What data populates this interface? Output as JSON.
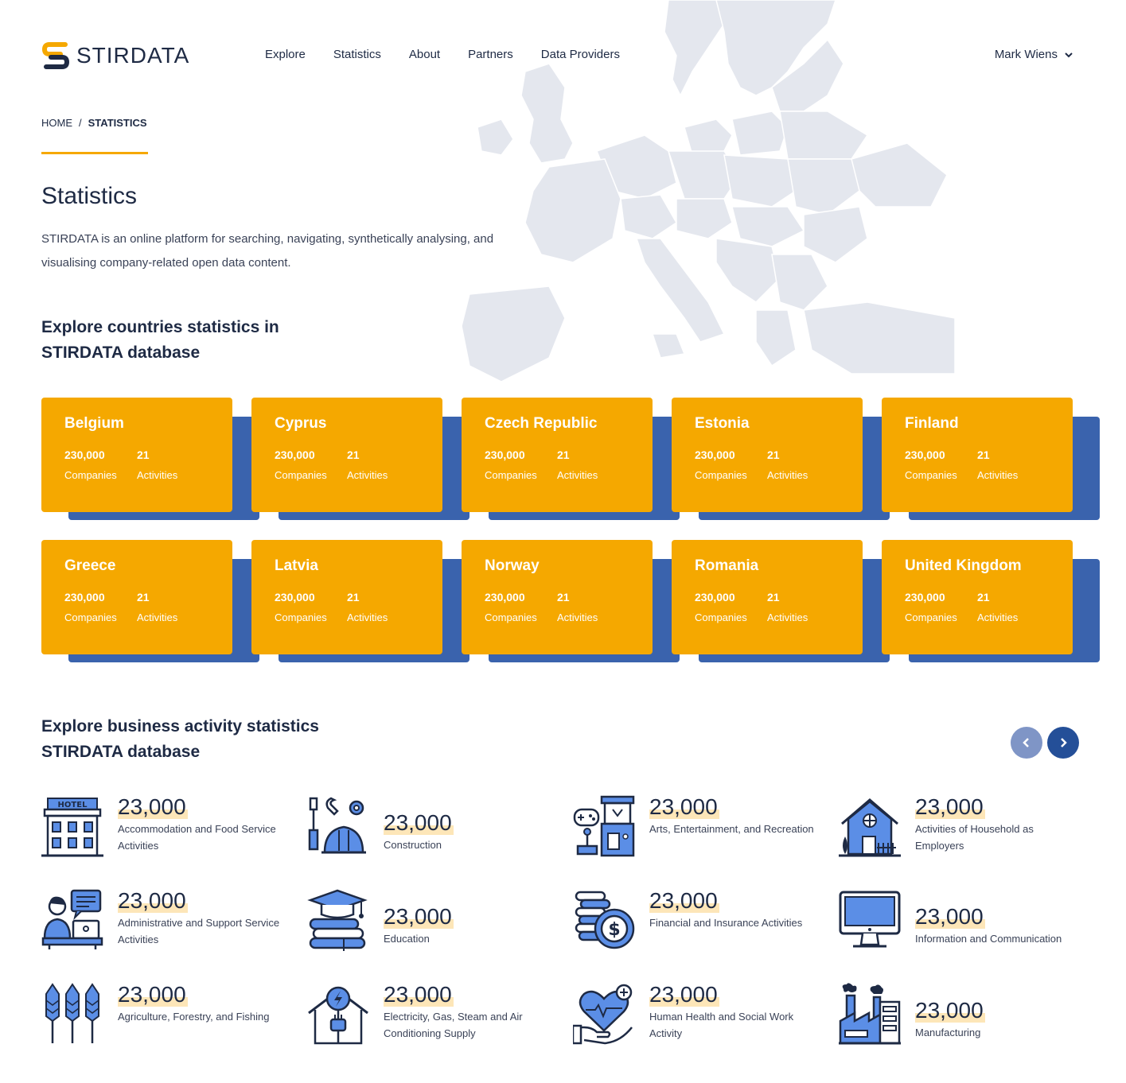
{
  "brand": {
    "name": "STIRDATA"
  },
  "nav": {
    "items": [
      "Explore",
      "Statistics",
      "About",
      "Partners",
      "Data Providers"
    ]
  },
  "user": {
    "name": "Mark Wiens"
  },
  "breadcrumb": {
    "home": "HOME",
    "separator": "/",
    "current": "STATISTICS"
  },
  "page": {
    "title": "Statistics",
    "intro": "STIRDATA is an online platform for searching, navigating, synthetically analysing, and visualising company-related open data content."
  },
  "countries_section": {
    "heading": "Explore countries statistics in STIRDATA database"
  },
  "countries": [
    {
      "name": "Belgium",
      "companies": "230,000",
      "companies_label": "Companies",
      "activities": "21",
      "activities_label": "Activities"
    },
    {
      "name": "Cyprus",
      "companies": "230,000",
      "companies_label": "Companies",
      "activities": "21",
      "activities_label": "Activities"
    },
    {
      "name": "Czech Republic",
      "companies": "230,000",
      "companies_label": "Companies",
      "activities": "21",
      "activities_label": "Activities"
    },
    {
      "name": "Estonia",
      "companies": "230,000",
      "companies_label": "Companies",
      "activities": "21",
      "activities_label": "Activities"
    },
    {
      "name": "Finland",
      "companies": "230,000",
      "companies_label": "Companies",
      "activities": "21",
      "activities_label": "Activities"
    },
    {
      "name": "Greece",
      "companies": "230,000",
      "companies_label": "Companies",
      "activities": "21",
      "activities_label": "Activities"
    },
    {
      "name": "Latvia",
      "companies": "230,000",
      "companies_label": "Companies",
      "activities": "21",
      "activities_label": "Activities"
    },
    {
      "name": "Norway",
      "companies": "230,000",
      "companies_label": "Companies",
      "activities": "21",
      "activities_label": "Activities"
    },
    {
      "name": "Romania",
      "companies": "230,000",
      "companies_label": "Companies",
      "activities": "21",
      "activities_label": "Activities"
    },
    {
      "name": "United Kingdom",
      "companies": "230,000",
      "companies_label": "Companies",
      "activities": "21",
      "activities_label": "Activities"
    }
  ],
  "activities_section": {
    "heading": "Explore business activity statistics STIRDATA database"
  },
  "activities": [
    {
      "count": "23,000",
      "name": "Accommodation and Food Service Activities",
      "icon": "hotel-icon"
    },
    {
      "count": "23,000",
      "name": "Construction",
      "icon": "construction-tools-icon"
    },
    {
      "count": "23,000",
      "name": "Arts, Entertainment, and Recreation",
      "icon": "arcade-machine-icon"
    },
    {
      "count": "23,000",
      "name": "Activities of Household as Employers",
      "icon": "house-icon"
    },
    {
      "count": "23,000",
      "name": "Administrative and Support Service Activities",
      "icon": "office-worker-icon"
    },
    {
      "count": "23,000",
      "name": "Education",
      "icon": "graduation-books-icon"
    },
    {
      "count": "23,000",
      "name": "Financial and Insurance Activities",
      "icon": "coins-dollar-icon"
    },
    {
      "count": "23,000",
      "name": "Information and Communication",
      "icon": "computer-monitor-icon"
    },
    {
      "count": "23,000",
      "name": "Agriculture, Forestry, and Fishing",
      "icon": "wheat-icon"
    },
    {
      "count": "23,000",
      "name": "Electricity, Gas, Steam and Air Conditioning Supply",
      "icon": "energy-plug-icon"
    },
    {
      "count": "23,000",
      "name": "Human Health and Social Work Activity",
      "icon": "heart-hand-icon"
    },
    {
      "count": "23,000",
      "name": "Manufacturing",
      "icon": "factory-icon"
    }
  ],
  "colors": {
    "accent": "#f5a800",
    "card_shadow": "#3a63ad",
    "icon_blue": "#5b8ee6",
    "text_dark": "#1e2a44"
  }
}
